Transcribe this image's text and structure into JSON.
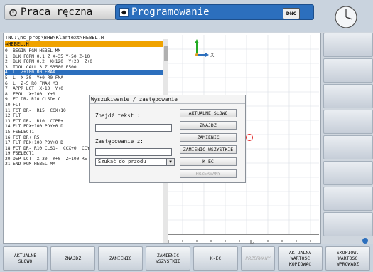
{
  "header": {
    "mode_left": "Praca ręczna",
    "mode_right": "Programowanie",
    "dnc": "DNC"
  },
  "editor": {
    "path": "TNC:\\nc_prog\\BHB\\Klartext\\HEBEL.H",
    "file": "→HEBEL.H",
    "selected_index": 4,
    "lines": [
      "0  BEGIN PGM HEBEL MM",
      "1  BLK FORM 0.1 Z X-35 Y-50 Z-10",
      "2  BLK FORM 0.2  X+120  Y+20  Z+0",
      "3  TOOL CALL 3 Z S3500 F500",
      "4  L  Z+100 R0 FMAX",
      "5  L  X-30  Y+0 R0 FMA",
      "6  L  Z-5 R0 FMAX M3",
      "7  APPR LCT  X-10  Y+0",
      "8  FPOL  X+100  Y+0",
      "9  FC DR- R10 CLSD+ C",
      "10 FLT",
      "11 FCT DR-  R15  CCX+10",
      "12 FLT",
      "13 FCT DR-  R10  CCPR+",
      "14 FLT PDX+100 PDY+0 D",
      "15 FSELECT1",
      "16 FCT DR+ R5",
      "17 FLT PDX+100 PDY+0 D",
      "18 FCT DR- R10 CLSD-  CCX+0  CCY+0",
      "19 FSELECT1",
      "20 DEP LCT  X-30  Y+0  Z+100 R5 FMAX",
      "21 END PGM HEBEL MM"
    ]
  },
  "graphic": {
    "axis_x": "X",
    "scale_zero": "0"
  },
  "dialog": {
    "title": "Wyszukiwanie / zastępowanie",
    "find_label": "Znajdź tekst :",
    "find_value": "",
    "replace_label": "Zastępowanie z:",
    "replace_value": "",
    "direction": "Szukać do przodu",
    "buttons": [
      "AKTUALNE SŁOWO",
      "ZNAJDZ",
      "ZAMIENIC",
      "ZAMIENIC WSZYSTKIE",
      "K-EC",
      "PRZERWANY"
    ],
    "disabled_button": "PRZERWANY"
  },
  "softkeys": [
    "AKTUALNE\nSŁOWO",
    "ZNAJDZ",
    "ZAMIENIC",
    "ZAMIENIC\nWSZYSTKIE",
    "K-EC",
    "PRZERWANY",
    "AKTUALNA\nWARTOSC\nKOPIOWAC",
    "SKOPIOW.\nWARTOSC\nWPROWADZ"
  ],
  "colors": {
    "accent": "#2c6fbd",
    "highlight": "#f0a300",
    "feed": "#e07000",
    "values": "#d03030"
  }
}
